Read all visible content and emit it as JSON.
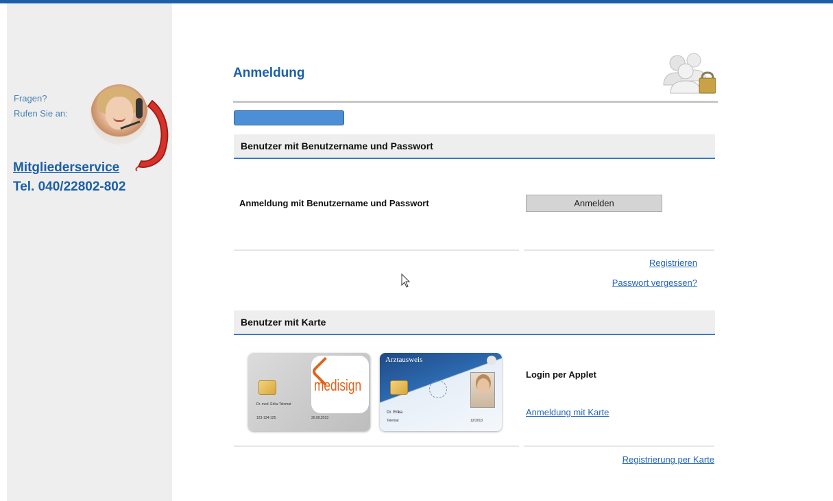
{
  "sidebar": {
    "question": "Fragen?",
    "call": "Rufen Sie an:",
    "service_link": "Mitgliederservice",
    "phone": "Tel. 040/22802-802"
  },
  "main": {
    "title": "Anmeldung",
    "section_password": {
      "header": "Benutzer mit Benutzername und Passwort",
      "label": "Anmeldung mit Benutzername und Passwort",
      "button": "Anmelden",
      "links": [
        "Registrieren",
        "Passwort vergessen?"
      ]
    },
    "section_card": {
      "header": "Benutzer mit Karte",
      "applet_label": "Login per Applet",
      "card_link": "Anmeldung mit Karte",
      "register_link": "Registrierung per Karte",
      "medisign_card": {
        "logo": "medisign",
        "holder": "Dr. med. Erika Telemat",
        "number": "123-134-125",
        "date": "30.09.2013"
      },
      "arztausweis_card": {
        "title": "Arztausweis",
        "name": "Dr. Erika",
        "surname": "Telemat",
        "date": "12/2013"
      }
    }
  },
  "colors": {
    "accent": "#1b5fa8",
    "link": "#2364b5",
    "progress": "#4d8fd6",
    "header_bg": "#eeeeee"
  }
}
